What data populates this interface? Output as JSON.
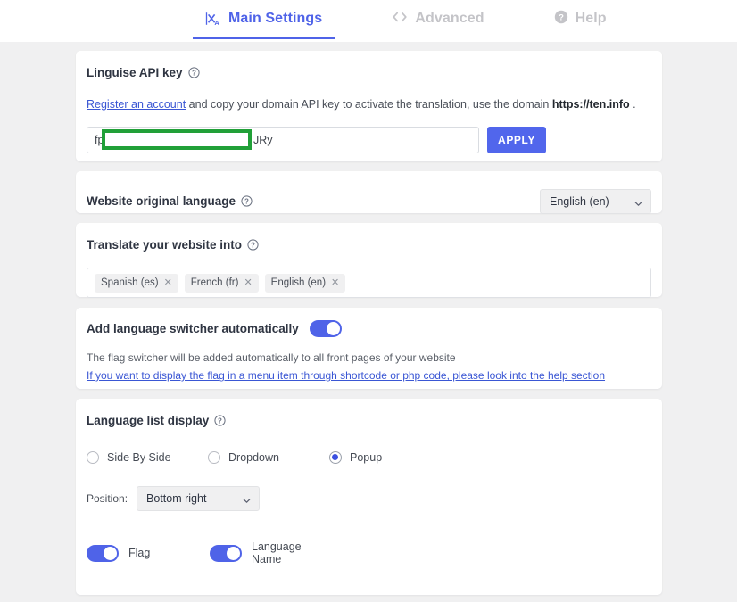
{
  "tabs": [
    {
      "label": "Main Settings",
      "icon": "translate-icon",
      "active": true
    },
    {
      "label": "Advanced",
      "icon": "code-brackets-icon",
      "active": false
    },
    {
      "label": "Help",
      "icon": "question-circle-icon",
      "active": false
    }
  ],
  "api_card": {
    "title": "Linguise API key",
    "help_icon": "question-mark-circle-icon",
    "desc_link": "Register an account",
    "desc_middle": " and copy your domain API key to activate the translation, use the domain ",
    "domain": "https://ten.info",
    "desc_end": " .",
    "key_prefix": "fp",
    "key_suffix": "JRy",
    "key_redacted": true,
    "apply_label": "APPLY"
  },
  "original_language": {
    "title": "Website original language",
    "help_icon": "question-mark-circle-icon",
    "selected": "English (en)"
  },
  "translate_into": {
    "title": "Translate your website into",
    "help_icon": "question-mark-circle-icon",
    "tags": [
      {
        "label": "Spanish (es)",
        "remove": "✕"
      },
      {
        "label": "French (fr)",
        "remove": "✕"
      },
      {
        "label": "English (en)",
        "remove": "✕"
      }
    ]
  },
  "switcher": {
    "title": "Add language switcher automatically",
    "enabled": true,
    "note": "The flag switcher will be added automatically to all front pages of your website",
    "help_link": "If you want to display the flag in a menu item through shortcode or php code, please look into the help section"
  },
  "language_list_display": {
    "title": "Language list display",
    "help_icon": "question-mark-circle-icon",
    "options": [
      {
        "label": "Side By Side",
        "selected": false
      },
      {
        "label": "Dropdown",
        "selected": false
      },
      {
        "label": "Popup",
        "selected": true
      }
    ],
    "position_label": "Position:",
    "position_value": "Bottom right",
    "toggles": [
      {
        "label": "Flag",
        "enabled": true
      },
      {
        "label": "Language Name",
        "enabled": true
      }
    ]
  },
  "colors": {
    "accent": "#4f63e8",
    "button": "#5166ec",
    "redaction": "#21a038",
    "page_bg": "#f0f0f1",
    "card_bg": "#ffffff",
    "link": "#3a56d4",
    "muted_tab": "#c4c4c8"
  }
}
